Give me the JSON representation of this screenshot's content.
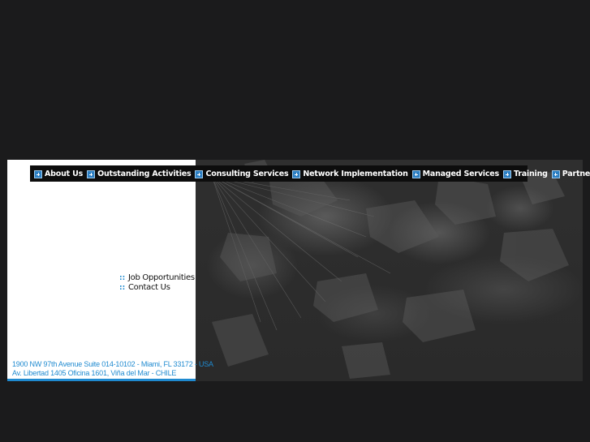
{
  "nav": {
    "items": [
      {
        "label": "About Us",
        "icon": "plus-icon"
      },
      {
        "label": "Outstanding Activities",
        "icon": "plus-icon"
      },
      {
        "label": "Consulting Services",
        "icon": "plus-icon"
      },
      {
        "label": "Network Implementation",
        "icon": "plus-icon"
      },
      {
        "label": "Managed Services",
        "icon": "plus-icon"
      },
      {
        "label": "Training",
        "icon": "plus-icon"
      },
      {
        "label": "Partners",
        "icon": "plus-icon"
      }
    ]
  },
  "side_links": {
    "bullet": "::",
    "items": [
      {
        "label": "Job Opportunities"
      },
      {
        "label": "Contact Us"
      }
    ]
  },
  "address": {
    "line1": "1900 NW 97th Avenue Suite 014-10102 - Miami, FL 33172 - USA",
    "line2": "Av. Libertad 1405 Oficina 1601, Viña del Mar - CHILE"
  },
  "colors": {
    "background": "#1b1b1c",
    "accent": "#1f8ad0",
    "nav_bar": "#0d0d0d"
  }
}
